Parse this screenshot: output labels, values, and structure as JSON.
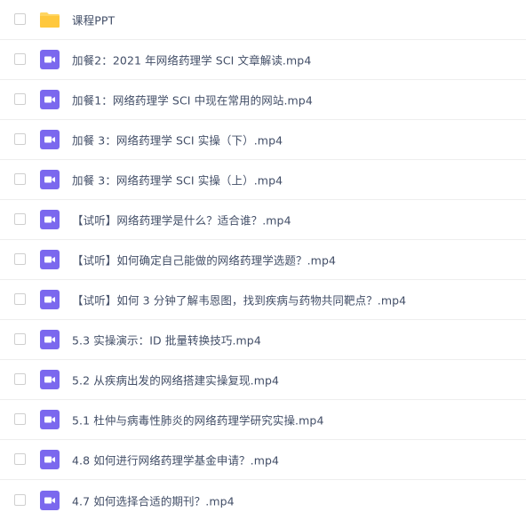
{
  "files": [
    {
      "name": "课程PPT",
      "type": "folder-icon"
    },
    {
      "name": "加餐2：2021 年网络药理学 SCI 文章解读.mp4",
      "type": "video-icon"
    },
    {
      "name": "加餐1：网络药理学 SCI 中现在常用的网站.mp4",
      "type": "video-icon"
    },
    {
      "name": "加餐 3：网络药理学 SCI 实操（下）.mp4",
      "type": "video-icon"
    },
    {
      "name": "加餐 3：网络药理学 SCI 实操（上）.mp4",
      "type": "video-icon"
    },
    {
      "name": "【试听】网络药理学是什么？适合谁？.mp4",
      "type": "video-icon"
    },
    {
      "name": "【试听】如何确定自己能做的网络药理学选题？.mp4",
      "type": "video-icon"
    },
    {
      "name": "【试听】如何 3 分钟了解韦恩图，找到疾病与药物共同靶点？.mp4",
      "type": "video-icon"
    },
    {
      "name": "5.3 实操演示：ID 批量转换技巧.mp4",
      "type": "video-icon"
    },
    {
      "name": "5.2 从疾病出发的网络搭建实操复现.mp4",
      "type": "video-icon"
    },
    {
      "name": "5.1 杜仲与病毒性肺炎的网络药理学研究实操.mp4",
      "type": "video-icon"
    },
    {
      "name": "4.8 如何进行网络药理学基金申请？.mp4",
      "type": "video-icon"
    },
    {
      "name": "4.7 如何选择合适的期刊？.mp4",
      "type": "video-icon"
    }
  ],
  "colors": {
    "folder": "#ffd561",
    "video": "#7b68ee",
    "text": "#424e67",
    "divider": "#eeeeee"
  }
}
